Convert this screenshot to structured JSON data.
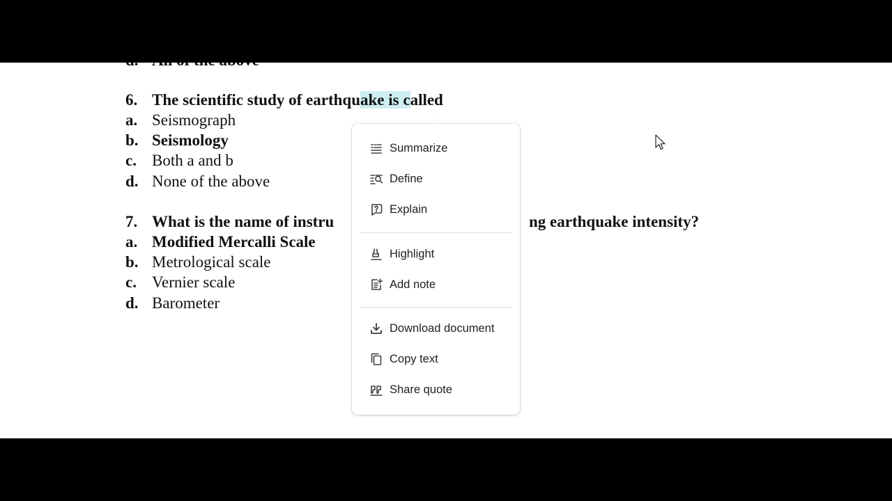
{
  "document": {
    "prev_answer": {
      "marker": "d.",
      "text": "All of the above"
    },
    "q6": {
      "marker": "6.",
      "text_before": "The scientific study of earthqu",
      "text_selected": "ake is c",
      "text_after": "alled",
      "options": [
        {
          "marker": "a.",
          "text": "Seismograph",
          "bold": false
        },
        {
          "marker": "b.",
          "text": "Seismology",
          "bold": true
        },
        {
          "marker": "c.",
          "text": "Both a and b",
          "bold": false
        },
        {
          "marker": "d.",
          "text": "None of the above",
          "bold": false
        }
      ]
    },
    "q7": {
      "marker": "7.",
      "text_left": "What is the name of instru",
      "text_right": "ng earthquake intensity?",
      "options": [
        {
          "marker": "a.",
          "text": "Modified Mercalli Scale",
          "bold": true
        },
        {
          "marker": "b.",
          "text": "Metrological scale",
          "bold": false
        },
        {
          "marker": "c.",
          "text": "Vernier scale",
          "bold": false
        },
        {
          "marker": "d.",
          "text": "Barometer",
          "bold": false
        }
      ]
    }
  },
  "context_menu": {
    "items": [
      {
        "label": "Summarize",
        "icon": "summarize-icon"
      },
      {
        "label": "Define",
        "icon": "define-icon"
      },
      {
        "label": "Explain",
        "icon": "explain-icon"
      },
      {
        "label": "Highlight",
        "icon": "highlight-icon"
      },
      {
        "label": "Add note",
        "icon": "add-note-icon"
      },
      {
        "label": "Download document",
        "icon": "download-icon"
      },
      {
        "label": "Copy text",
        "icon": "copy-icon"
      },
      {
        "label": "Share quote",
        "icon": "quote-icon"
      }
    ]
  },
  "colors": {
    "selection": "#cdeef2",
    "menu_text": "#202124",
    "divider": "#dadce0"
  }
}
